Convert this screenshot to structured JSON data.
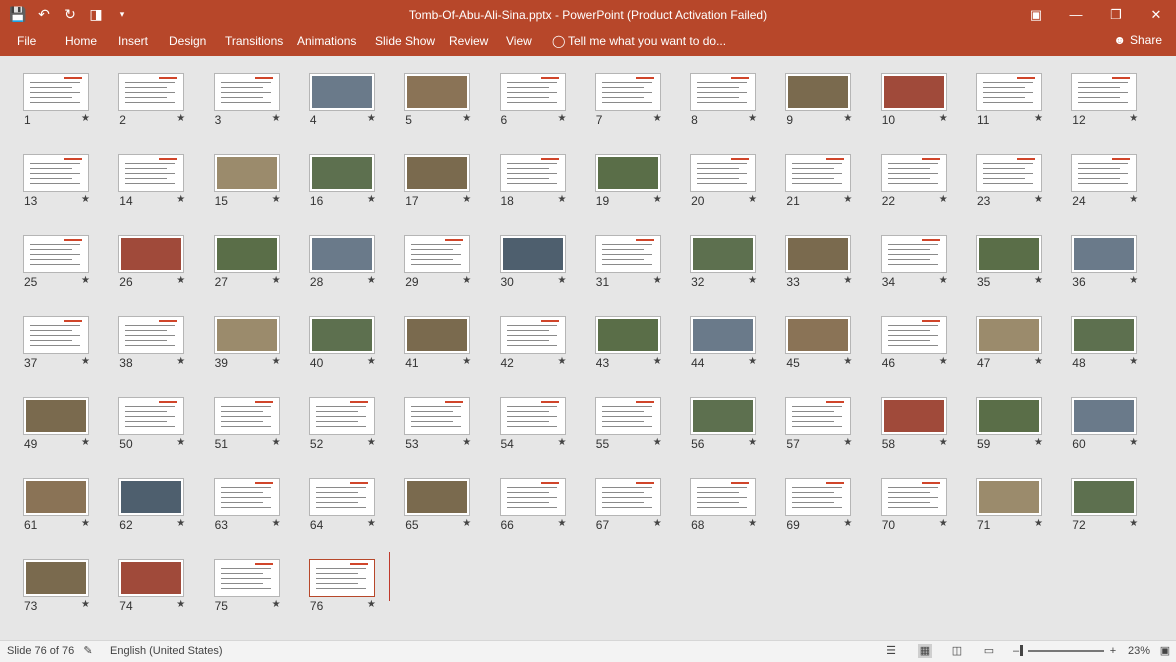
{
  "titlebar": {
    "title": "Tomb-Of-Abu-Ali-Sina.pptx  -  PowerPoint (Product Activation Failed)",
    "qat_icons": [
      "save-icon",
      "undo-icon",
      "redo-icon",
      "slideshow-icon",
      "customize-icon"
    ]
  },
  "ribbon": {
    "tabs": [
      "File",
      "Home",
      "Insert",
      "Design",
      "Transitions",
      "Animations",
      "Slide Show",
      "Review",
      "View"
    ],
    "tell_me": "Tell me what you want to do...",
    "share": "Share"
  },
  "slides": {
    "count": 76,
    "selected": 76,
    "numbers": [
      "1",
      "2",
      "3",
      "4",
      "5",
      "6",
      "7",
      "8",
      "9",
      "10",
      "11",
      "12",
      "13",
      "14",
      "15",
      "16",
      "17",
      "18",
      "19",
      "20",
      "21",
      "22",
      "23",
      "24",
      "25",
      "26",
      "27",
      "28",
      "29",
      "30",
      "31",
      "32",
      "33",
      "34",
      "35",
      "36",
      "37",
      "38",
      "39",
      "40",
      "41",
      "42",
      "43",
      "44",
      "45",
      "46",
      "47",
      "48",
      "49",
      "50",
      "51",
      "52",
      "53",
      "54",
      "55",
      "56",
      "57",
      "58",
      "59",
      "60",
      "61",
      "62",
      "63",
      "64",
      "65",
      "66",
      "67",
      "68",
      "69",
      "70",
      "71",
      "72",
      "73",
      "74",
      "75",
      "76"
    ],
    "star": "★"
  },
  "status": {
    "slide_info": "Slide 76 of 76",
    "language": "English (United States)",
    "zoom": "23%"
  },
  "colors": {
    "accent": "#b7472a",
    "workspace": "#e6e6e6"
  }
}
